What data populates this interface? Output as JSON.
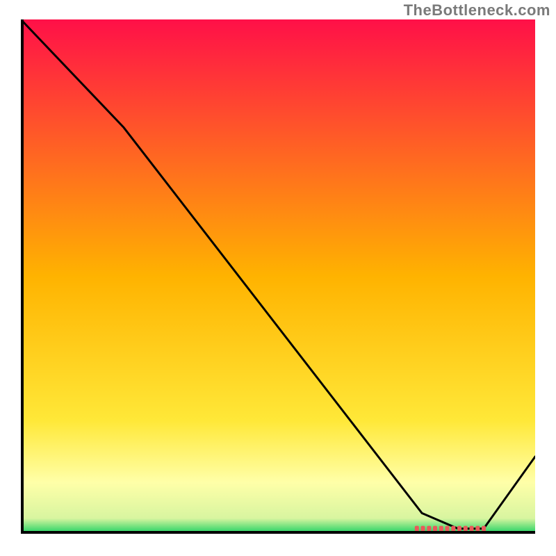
{
  "watermark": "TheBottleneck.com",
  "chart_data": {
    "type": "line",
    "title": "",
    "xlabel": "",
    "ylabel": "",
    "xlim": [
      0,
      100
    ],
    "ylim": [
      0,
      100
    ],
    "series": [
      {
        "name": "curve",
        "x": [
          0,
          20,
          78,
          85,
          90,
          100
        ],
        "values": [
          100,
          79,
          4,
          1,
          1,
          15
        ]
      }
    ],
    "marker_range_x": [
      77,
      90
    ],
    "gradient": {
      "type": "vertical",
      "stops": [
        {
          "offset": 0.0,
          "color": "#ff1048"
        },
        {
          "offset": 0.5,
          "color": "#ffb300"
        },
        {
          "offset": 0.78,
          "color": "#ffe838"
        },
        {
          "offset": 0.9,
          "color": "#ffffa8"
        },
        {
          "offset": 0.97,
          "color": "#d8f5a0"
        },
        {
          "offset": 1.0,
          "color": "#18d060"
        }
      ]
    },
    "axis_color": "#000000",
    "curve_color": "#000000",
    "marker_color": "#e85a5a"
  }
}
